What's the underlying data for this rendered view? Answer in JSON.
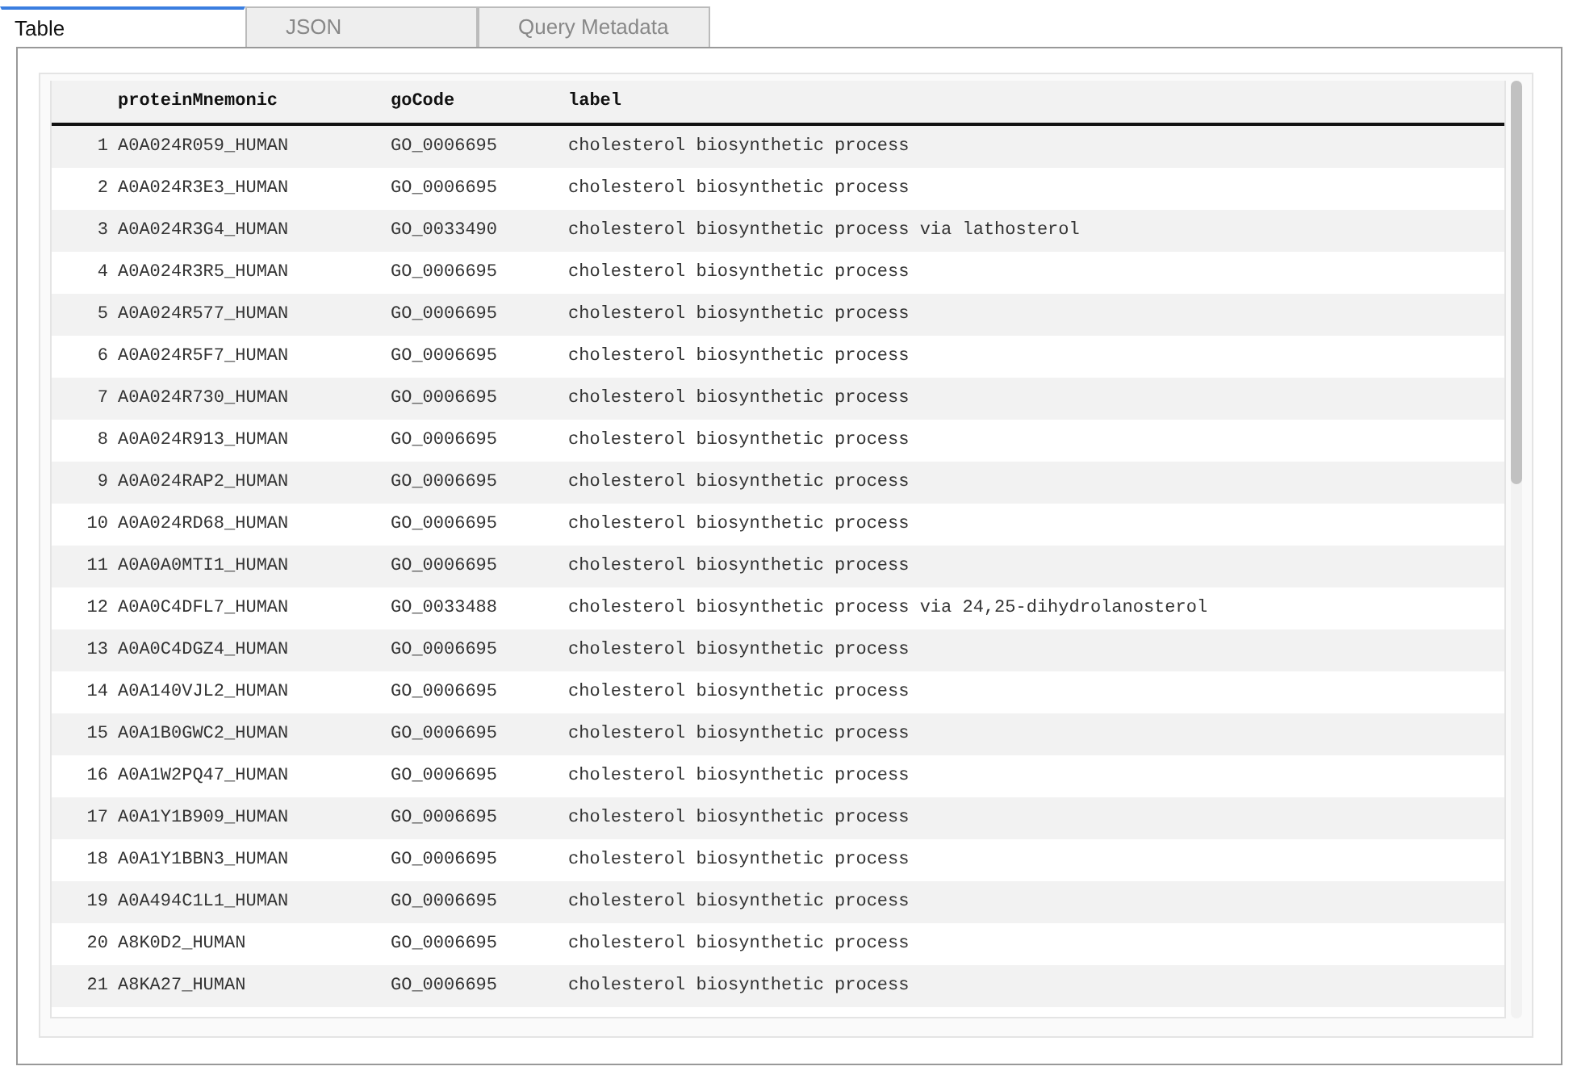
{
  "tabs": [
    {
      "label": "Table",
      "selected": true
    },
    {
      "label": "JSON",
      "selected": false
    },
    {
      "label": "Query Metadata",
      "selected": false
    }
  ],
  "table": {
    "columns": [
      "proteinMnemonic",
      "goCode",
      "label"
    ],
    "rows": [
      {
        "index": "1",
        "proteinMnemonic": "A0A024R059_HUMAN",
        "goCode": "GO_0006695",
        "label": "cholesterol biosynthetic process"
      },
      {
        "index": "2",
        "proteinMnemonic": "A0A024R3E3_HUMAN",
        "goCode": "GO_0006695",
        "label": "cholesterol biosynthetic process"
      },
      {
        "index": "3",
        "proteinMnemonic": "A0A024R3G4_HUMAN",
        "goCode": "GO_0033490",
        "label": "cholesterol biosynthetic process via lathosterol"
      },
      {
        "index": "4",
        "proteinMnemonic": "A0A024R3R5_HUMAN",
        "goCode": "GO_0006695",
        "label": "cholesterol biosynthetic process"
      },
      {
        "index": "5",
        "proteinMnemonic": "A0A024R577_HUMAN",
        "goCode": "GO_0006695",
        "label": "cholesterol biosynthetic process"
      },
      {
        "index": "6",
        "proteinMnemonic": "A0A024R5F7_HUMAN",
        "goCode": "GO_0006695",
        "label": "cholesterol biosynthetic process"
      },
      {
        "index": "7",
        "proteinMnemonic": "A0A024R730_HUMAN",
        "goCode": "GO_0006695",
        "label": "cholesterol biosynthetic process"
      },
      {
        "index": "8",
        "proteinMnemonic": "A0A024R913_HUMAN",
        "goCode": "GO_0006695",
        "label": "cholesterol biosynthetic process"
      },
      {
        "index": "9",
        "proteinMnemonic": "A0A024RAP2_HUMAN",
        "goCode": "GO_0006695",
        "label": "cholesterol biosynthetic process"
      },
      {
        "index": "10",
        "proteinMnemonic": "A0A024RD68_HUMAN",
        "goCode": "GO_0006695",
        "label": "cholesterol biosynthetic process"
      },
      {
        "index": "11",
        "proteinMnemonic": "A0A0A0MTI1_HUMAN",
        "goCode": "GO_0006695",
        "label": "cholesterol biosynthetic process"
      },
      {
        "index": "12",
        "proteinMnemonic": "A0A0C4DFL7_HUMAN",
        "goCode": "GO_0033488",
        "label": "cholesterol biosynthetic process via 24,25-dihydrolanosterol"
      },
      {
        "index": "13",
        "proteinMnemonic": "A0A0C4DGZ4_HUMAN",
        "goCode": "GO_0006695",
        "label": "cholesterol biosynthetic process"
      },
      {
        "index": "14",
        "proteinMnemonic": "A0A140VJL2_HUMAN",
        "goCode": "GO_0006695",
        "label": "cholesterol biosynthetic process"
      },
      {
        "index": "15",
        "proteinMnemonic": "A0A1B0GWC2_HUMAN",
        "goCode": "GO_0006695",
        "label": "cholesterol biosynthetic process"
      },
      {
        "index": "16",
        "proteinMnemonic": "A0A1W2PQ47_HUMAN",
        "goCode": "GO_0006695",
        "label": "cholesterol biosynthetic process"
      },
      {
        "index": "17",
        "proteinMnemonic": "A0A1Y1B909_HUMAN",
        "goCode": "GO_0006695",
        "label": "cholesterol biosynthetic process"
      },
      {
        "index": "18",
        "proteinMnemonic": "A0A1Y1BBN3_HUMAN",
        "goCode": "GO_0006695",
        "label": "cholesterol biosynthetic process"
      },
      {
        "index": "19",
        "proteinMnemonic": "A0A494C1L1_HUMAN",
        "goCode": "GO_0006695",
        "label": "cholesterol biosynthetic process"
      },
      {
        "index": "20",
        "proteinMnemonic": "A8K0D2_HUMAN",
        "goCode": "GO_0006695",
        "label": "cholesterol biosynthetic process"
      },
      {
        "index": "21",
        "proteinMnemonic": "A8KA27_HUMAN",
        "goCode": "GO_0006695",
        "label": "cholesterol biosynthetic process"
      }
    ]
  }
}
